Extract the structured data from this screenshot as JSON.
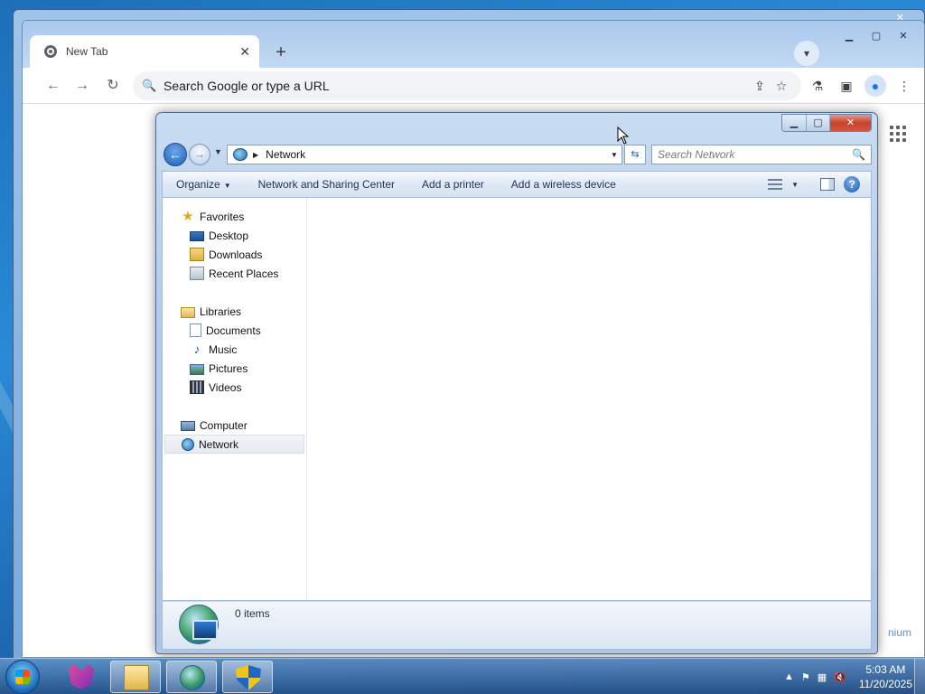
{
  "chrome": {
    "tab_title": "New Tab",
    "tab_close": "✕",
    "new_tab": "+",
    "omnibox_placeholder": "Search Google or type a URL",
    "peek_text": "nium",
    "caption_buttons": {
      "minimize": "▁",
      "maximize": "▢",
      "close": "✕"
    }
  },
  "explorer": {
    "caption_buttons": {
      "minimize": "▁",
      "maximize": "▢",
      "close": "✕"
    },
    "address": {
      "location": "Network"
    },
    "search": {
      "placeholder": "Search Network"
    },
    "command_bar": {
      "organize": "Organize",
      "commands": [
        "Network and Sharing Center",
        "Add a printer",
        "Add a wireless device"
      ]
    },
    "nav_pane": {
      "favorites": {
        "label": "Favorites",
        "items": [
          "Desktop",
          "Downloads",
          "Recent Places"
        ]
      },
      "libraries": {
        "label": "Libraries",
        "items": [
          "Documents",
          "Music",
          "Pictures",
          "Videos"
        ]
      },
      "computer": "Computer",
      "network": "Network",
      "selected": "Network"
    },
    "details": {
      "item_count": "0 items"
    }
  },
  "taskbar": {
    "clock_time": "5:03 AM",
    "clock_date": "11/20/2025",
    "pinned": [
      "Explorer Folder",
      "Network",
      "Security Shield"
    ],
    "tray_icons": [
      "show-hidden-icons-arrow",
      "action-center-flag",
      "network-icon",
      "volume-muted-icon"
    ]
  },
  "icons": {
    "search": "🔍",
    "favorites_star": "★",
    "music_note": "♪"
  }
}
